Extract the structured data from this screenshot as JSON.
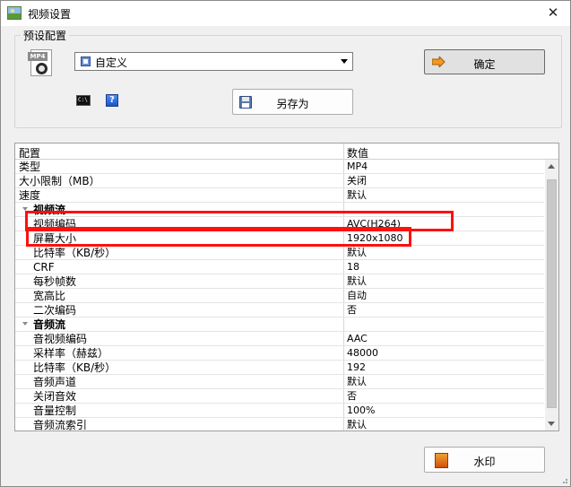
{
  "window": {
    "title": "视频设置",
    "close_glyph": "✕"
  },
  "preset": {
    "group_label": "预设配置",
    "format_icon_label": "MP4",
    "select_value": "自定义",
    "ok_label": "确定",
    "cmd_icon_text": "C:\\",
    "help_icon_text": "?",
    "saveas_label": "另存为"
  },
  "grid": {
    "header_name": "配置",
    "header_value": "数值",
    "rows": [
      {
        "name": "类型",
        "value": "MP4",
        "kind": "item",
        "indent": 0
      },
      {
        "name": "大小限制（MB）",
        "value": "关闭",
        "kind": "item",
        "indent": 0
      },
      {
        "name": "速度",
        "value": "默认",
        "kind": "item",
        "indent": 0
      },
      {
        "name": "视频流",
        "value": "",
        "kind": "category",
        "indent": 1
      },
      {
        "name": "视频编码",
        "value": "AVC(H264)",
        "kind": "item",
        "indent": 1
      },
      {
        "name": "屏幕大小",
        "value": "1920x1080",
        "kind": "item",
        "indent": 1
      },
      {
        "name": "比特率（KB/秒）",
        "value": "默认",
        "kind": "item",
        "indent": 1
      },
      {
        "name": "CRF",
        "value": "18",
        "kind": "item",
        "indent": 1
      },
      {
        "name": "每秒帧数",
        "value": "默认",
        "kind": "item",
        "indent": 1
      },
      {
        "name": "宽高比",
        "value": "自动",
        "kind": "item",
        "indent": 1
      },
      {
        "name": "二次编码",
        "value": "否",
        "kind": "item",
        "indent": 1
      },
      {
        "name": "音频流",
        "value": "",
        "kind": "category",
        "indent": 1
      },
      {
        "name": "音视频编码",
        "value": "AAC",
        "kind": "item",
        "indent": 1
      },
      {
        "name": "采样率（赫兹）",
        "value": "48000",
        "kind": "item",
        "indent": 1
      },
      {
        "name": "比特率（KB/秒）",
        "value": "192",
        "kind": "item",
        "indent": 1
      },
      {
        "name": "音频声道",
        "value": "默认",
        "kind": "item",
        "indent": 1
      },
      {
        "name": "关闭音效",
        "value": "否",
        "kind": "item",
        "indent": 1
      },
      {
        "name": "音量控制",
        "value": "100%",
        "kind": "item",
        "indent": 1
      },
      {
        "name": "音频流索引",
        "value": "默认",
        "kind": "item",
        "indent": 1
      }
    ]
  },
  "watermark": {
    "label": "水印"
  },
  "colors": {
    "highlight": "#ff0f0f",
    "window_bg": "#f0f0f0"
  }
}
